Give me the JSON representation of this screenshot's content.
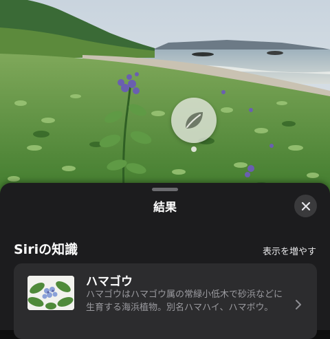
{
  "photo": {
    "subject": "beach-vitex-plant-photo"
  },
  "visual_lookup": {
    "icon": "leaf-icon"
  },
  "sheet": {
    "title": "結果",
    "close_icon": "close-icon",
    "section": {
      "title": "Siriの知識",
      "show_more": "表示を増やす"
    },
    "result": {
      "name": "ハマゴウ",
      "description": "ハマゴウはハマゴウ属の常緑小低木で砂浜などに生育する海浜植物。別名ハマハイ、ハマボウ。",
      "chevron_icon": "chevron-right-icon"
    }
  },
  "colors": {
    "sheet_bg": "#1c1c1e",
    "card_bg": "#2c2c2e",
    "secondary_text": "#9b9ba0"
  }
}
